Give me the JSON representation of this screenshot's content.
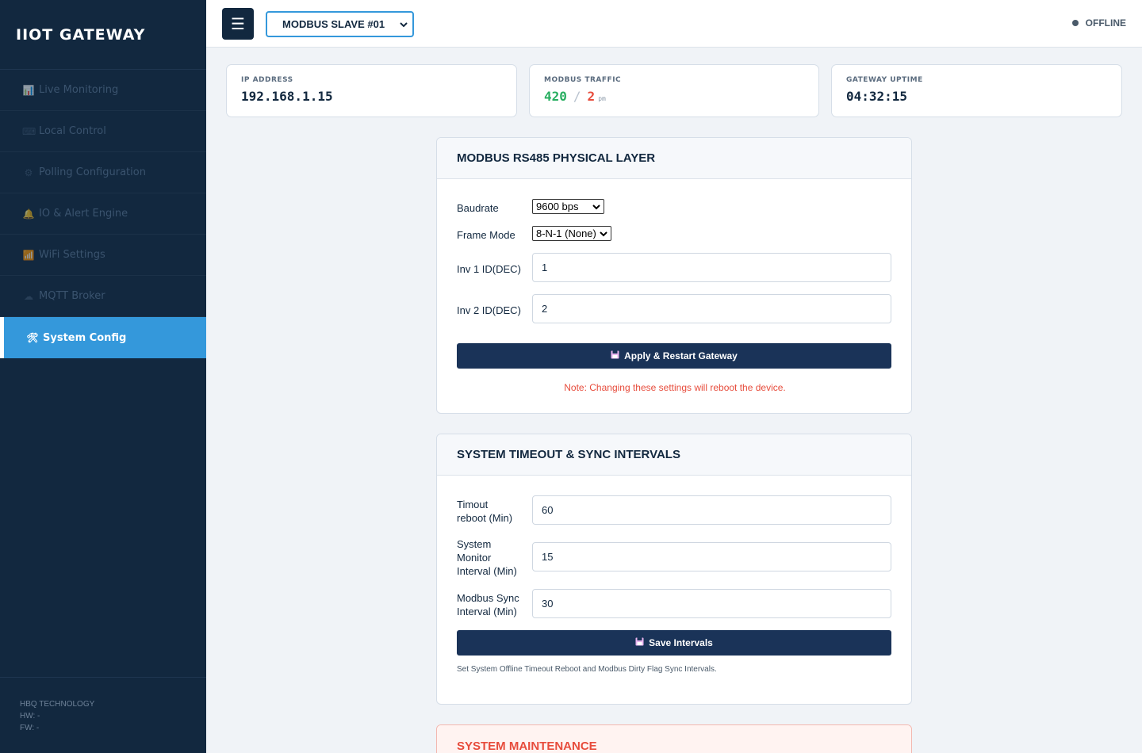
{
  "sidebar": {
    "brand": "IIOT GATEWAY",
    "items": [
      {
        "label": "Live Monitoring",
        "icon": "📊"
      },
      {
        "label": "Local Control",
        "icon": "⌨"
      },
      {
        "label": "Polling Configuration",
        "icon": "⚙"
      },
      {
        "label": "IO & Alert Engine",
        "icon": "🔔"
      },
      {
        "label": "WiFi Settings",
        "icon": "📶"
      },
      {
        "label": "MQTT Broker",
        "icon": "☁"
      },
      {
        "label": "System Config",
        "icon": "🛠",
        "active": true
      }
    ],
    "footer": {
      "company": "HBQ TECHNOLOGY",
      "hw": "HW: -",
      "fw": "FW: -"
    }
  },
  "header": {
    "menu_icon": "☰",
    "slave_selected": "MODBUS SLAVE #01",
    "status": "OFFLINE"
  },
  "stats": {
    "ip": {
      "label": "IP ADDRESS",
      "value": "192.168.1.15"
    },
    "traffic": {
      "label": "MODBUS TRAFFIC",
      "ok": "420",
      "separator": "/",
      "err": "2",
      "unit": "pm"
    },
    "uptime": {
      "label": "GATEWAY UPTIME",
      "value": "04:32:15"
    }
  },
  "rs485": {
    "title": "MODBUS RS485 PHYSICAL LAYER",
    "baudrate_label": "Baudrate",
    "baudrate_value": "9600 bps",
    "frame_label": "Frame Mode",
    "frame_value": "8-N-1 (None)",
    "inv1_label": "Inv 1 ID(DEC)",
    "inv1_value": "1",
    "inv2_label": "Inv 2 ID(DEC)",
    "inv2_value": "2",
    "apply_label": "Apply & Restart Gateway",
    "note": "Note: Changing these settings will reboot the device."
  },
  "timeouts": {
    "title": "SYSTEM TIMEOUT & SYNC INTERVALS",
    "reboot_label_1": "Timout",
    "reboot_label_2": "reboot (Min)",
    "reboot_value": "60",
    "monitor_label_1": "System",
    "monitor_label_2": "Monitor",
    "monitor_label_3": "Interval (Min)",
    "monitor_value": "15",
    "sync_label_1": "Modbus Sync",
    "sync_label_2": "Interval (Min)",
    "sync_value": "30",
    "save_label": "Save Intervals",
    "note": "Set System Offline Timeout Reboot and Modbus Dirty Flag Sync Intervals."
  },
  "maintenance": {
    "title": "SYSTEM MAINTENANCE"
  },
  "colors": {
    "accent": "#3498db",
    "sidebar": "#12283f",
    "button": "#1a3358",
    "danger": "#e74c3c",
    "success": "#27ae60"
  }
}
